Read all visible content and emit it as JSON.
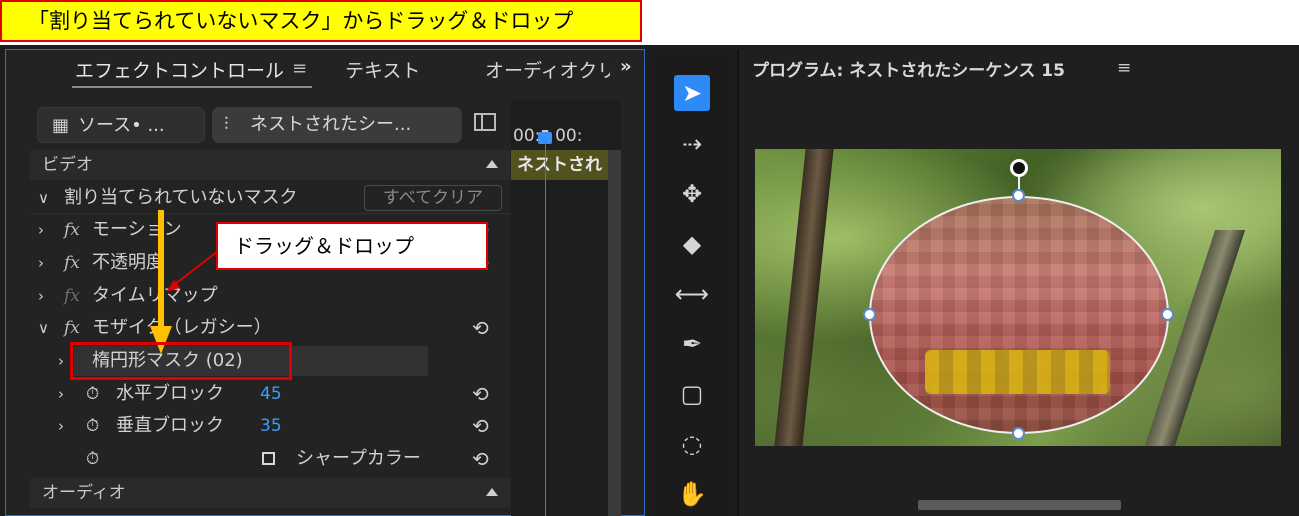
{
  "banner": {
    "text": "「割り当てられていないマスク」からドラッグ＆ドロップ"
  },
  "effect_controls": {
    "tabs": [
      {
        "label": "エフェクトコントロール",
        "menu": "≡"
      },
      {
        "label": "テキスト"
      },
      {
        "label": "オーディオクリ"
      }
    ],
    "more": "»",
    "source_label": "ソース• ...",
    "sequence_label": "ネストされたシー...",
    "video_section": "ビデオ",
    "audio_section": "オーディオ",
    "rows": {
      "unassigned_mask": "割り当てられていないマスク",
      "clear_all": "すべてクリア",
      "motion": "モーション",
      "opacity": "不透明度",
      "time_remap": "タイムリマップ",
      "mosaic": "モザイク（レガシー）",
      "ellipse_mask": "楕円形マスク (02)",
      "h_blocks": "水平ブロック",
      "h_blocks_value": "45",
      "v_blocks": "垂直ブロック",
      "v_blocks_value": "35",
      "sharp_colors": "シャープカラー"
    },
    "fx_symbol": "fx",
    "timeline": {
      "ruler": "00:▮ 00:",
      "clip": "ネストされ"
    }
  },
  "callout": {
    "text": "ドラッグ＆ドロップ"
  },
  "toolbar": {
    "tools": [
      "selection-tool",
      "track-select-tool",
      "ripple-edit-tool",
      "razor-tool",
      "slip-tool",
      "pen-tool",
      "rectangle-tool",
      "ellipse-tool",
      "hand-tool"
    ]
  },
  "program_monitor": {
    "title": "プログラム: ネストされたシーケンス 15",
    "menu": "≡"
  }
}
